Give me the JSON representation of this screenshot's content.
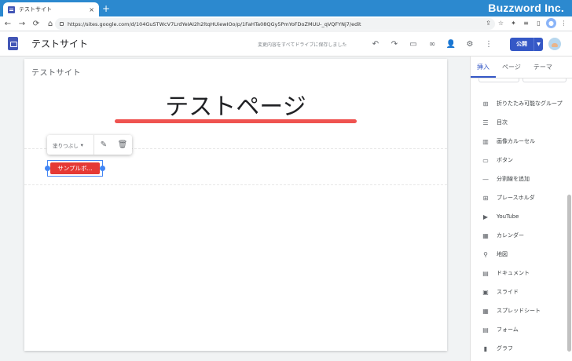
{
  "browser": {
    "tab_title": "テストサイト",
    "tab_close": "×",
    "new_tab": "+",
    "brand": "Buzzword Inc.",
    "url": "https://sites.google.com/d/104GuSTWcV7LrdYeIAI2h2ltqHUiewIOo/p/1FaHTa08QGy5PmYoFDoZMUU-_qVQFYNj7/edit"
  },
  "app": {
    "site_name": "テストサイト",
    "saved_message": "変更内容をすべてドライブに保存しました",
    "publish_label": "公開"
  },
  "canvas": {
    "header_title": "テストサイト",
    "page_title": "テストページ",
    "toolbar_style": "塗りつぶし",
    "sample_button": "サンプルボ..."
  },
  "panel": {
    "tabs": [
      "挿入",
      "ページ",
      "テーマ"
    ],
    "items": [
      {
        "icon": "collapsible-group-icon",
        "label": "折りたたみ可能なグループ"
      },
      {
        "icon": "toc-icon",
        "label": "目次"
      },
      {
        "icon": "carousel-icon",
        "label": "画像カルーセル"
      },
      {
        "icon": "button-icon",
        "label": "ボタン"
      },
      {
        "icon": "divider-icon",
        "label": "分割線を追加"
      },
      {
        "icon": "placeholder-icon",
        "label": "プレースホルダ"
      },
      {
        "icon": "youtube-icon",
        "label": "YouTube"
      },
      {
        "icon": "calendar-icon",
        "label": "カレンダー"
      },
      {
        "icon": "map-pin-icon",
        "label": "地図"
      },
      {
        "icon": "docs-icon",
        "label": "ドキュメント"
      },
      {
        "icon": "slides-icon",
        "label": "スライド"
      },
      {
        "icon": "sheets-icon",
        "label": "スプレッドシート"
      },
      {
        "icon": "forms-icon",
        "label": "フォーム"
      },
      {
        "icon": "chart-icon",
        "label": "グラフ"
      }
    ]
  },
  "colors": {
    "accent": "#3558c6",
    "title_underline": "#ef5350",
    "sample_button": "#e53935",
    "browser_bar": "#2c89cf"
  }
}
